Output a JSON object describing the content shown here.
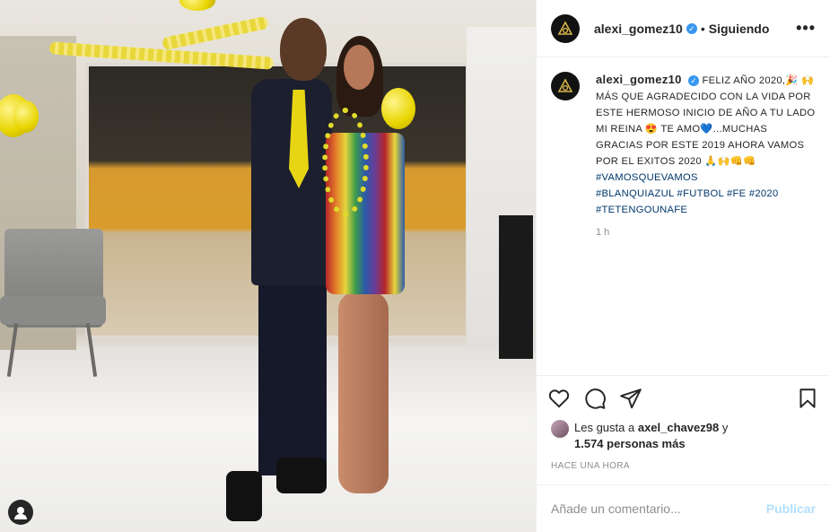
{
  "post": {
    "username": "alexi_gomez10",
    "follow_status": "Siguiendo",
    "separator": "•",
    "more_label": "•••",
    "caption": {
      "username": "alexi_gomez10",
      "text_line1": "FELIZ AÑO 2020,🎉",
      "text_line2": "🙌 MÁS QUE AGRADECIDO CON LA VIDA POR ESTE HERMOSO INICIO DE AÑO A TU LADO MI REINA 😍 TE AMO💙...MUCHAS GRACIAS POR ESTE 2019 AHORA VAMOS POR EL EXITOS 2020 🙏🙌👊👊",
      "hashtags": [
        "#VAMOSQUEVAMOS",
        "#BLANQUIAZUL",
        "#FUTBOL",
        "#FE",
        "#2020",
        "#TETENGOUNAFE"
      ],
      "time": "1 h"
    },
    "likes": {
      "prefix": "Les gusta a",
      "user": "axel_chavez98",
      "conj": "y",
      "count": "1.574 personas más"
    },
    "timestamp": "HACE UNA HORA",
    "comment": {
      "placeholder": "Añade un comentario...",
      "publish": "Publicar"
    }
  },
  "icons": [
    "heart-icon",
    "comment-icon",
    "share-icon",
    "bookmark-icon",
    "verified-icon",
    "more-options-icon",
    "user-tag-icon"
  ],
  "colors": {
    "verified": "#3897f0",
    "publish_disabled": "#b2dffc",
    "hashtag": "#00376b",
    "balloon": "#e8d500"
  }
}
